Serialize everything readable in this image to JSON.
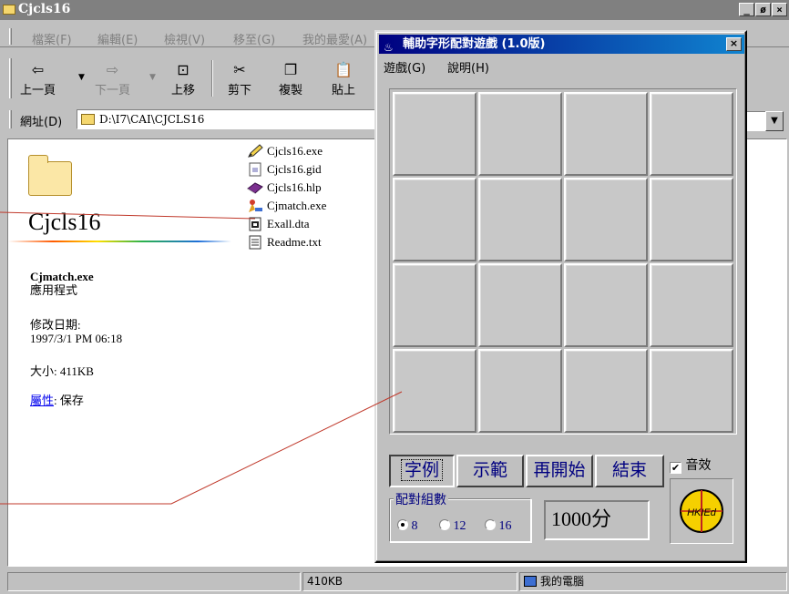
{
  "explorer": {
    "title": "Cjcls16",
    "caption_buttons": [
      "_",
      "ø",
      "×"
    ],
    "menu": [
      "檔案(F)",
      "編輯(E)",
      "檢視(V)",
      "移至(G)",
      "我的最愛(A)"
    ],
    "toolbar": {
      "back": "上一頁",
      "forward": "下一頁",
      "up": "上移",
      "cut": "剪下",
      "copy": "複製",
      "paste": "貼上"
    },
    "address_label": "網址(D)",
    "address_value": "D:\\I7\\CAI\\CJCLS16",
    "folder_title": "Cjcls16",
    "selected": {
      "name": "Cjmatch.exe",
      "type": "應用程式",
      "modified_label": "修改日期:",
      "modified_value": "1997/3/1 PM 06:18",
      "size": "大小: 411KB",
      "props_link": "屬性",
      "props_rest": ": 保存"
    },
    "files": [
      {
        "name": "Cjcls16.exe",
        "icon": "pencil-icon"
      },
      {
        "name": "Cjcls16.gid",
        "icon": "document-icon"
      },
      {
        "name": "Cjcls16.hlp",
        "icon": "help-book-icon"
      },
      {
        "name": "Cjmatch.exe",
        "icon": "app-icon"
      },
      {
        "name": "Exall.dta",
        "icon": "data-file-icon"
      },
      {
        "name": "Readme.txt",
        "icon": "text-file-icon"
      }
    ],
    "status": {
      "size": "410KB",
      "location": "我的電腦"
    }
  },
  "game": {
    "title": "輔助字形配對遊戲 (1.0版)",
    "menu": [
      "遊戲(G)",
      "說明(H)"
    ],
    "grid": {
      "rows": 4,
      "cols": 4
    },
    "buttons": {
      "example": "字例",
      "demo": "示範",
      "restart": "再開始",
      "end": "結束"
    },
    "sound_label": "音效",
    "sound_checked": true,
    "group_label": "配對組數",
    "pair_options": [
      "8",
      "12",
      "16"
    ],
    "pair_selected": "8",
    "score": "1000分",
    "logo_text": "HKIEd"
  },
  "colors": {
    "annotation_line": "#c0392b",
    "dialog_title_start": "#000080",
    "dialog_title_end": "#1084d0",
    "tile": "#c8c8c8"
  }
}
